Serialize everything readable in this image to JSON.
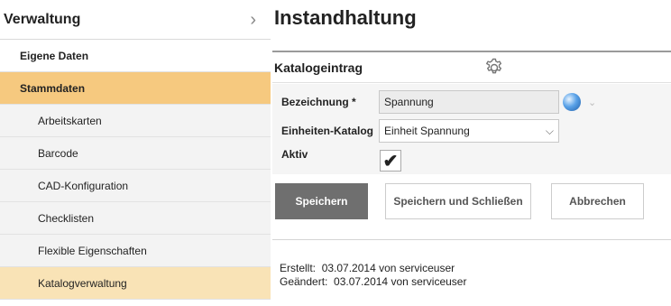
{
  "sidebar": {
    "header": "Verwaltung",
    "chevron_icon": "chevron-right-icon",
    "items": [
      {
        "label": "Eigene Daten"
      },
      {
        "label": "Stammdaten"
      },
      {
        "label": "Arbeitskarten"
      },
      {
        "label": "Barcode"
      },
      {
        "label": "CAD-Konfiguration"
      },
      {
        "label": "Checklisten"
      },
      {
        "label": "Flexible Eigenschaften"
      },
      {
        "label": "Katalogverwaltung"
      }
    ]
  },
  "main": {
    "title": "Instandhaltung",
    "panel_title": "Katalogeintrag",
    "settings_icon": "gear-icon",
    "fields": {
      "bezeichnung_label": "Bezeichnung *",
      "bezeichnung_value": "Spannung",
      "einheiten_label": "Einheiten-Katalog",
      "einheiten_value": "Einheit Spannung",
      "aktiv_label": "Aktiv",
      "aktiv_checked": true
    },
    "buttons": {
      "save": "Speichern",
      "save_close": "Speichern und Schließen",
      "cancel": "Abbrechen"
    },
    "meta": {
      "created_label": "Erstellt:",
      "created_value": "03.07.2014 von serviceuser",
      "changed_label": "Geändert:",
      "changed_value": "03.07.2014 von serviceuser"
    }
  },
  "colors": {
    "active_primary": "#f6c97f",
    "active_secondary": "#f9e3b6",
    "primary_button": "#6f6f6f"
  }
}
